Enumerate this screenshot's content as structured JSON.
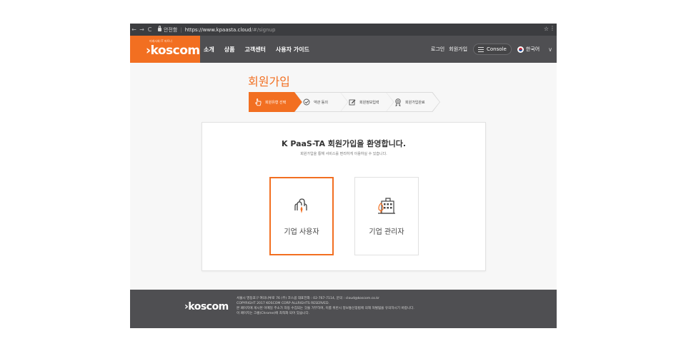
{
  "browser": {
    "back_icon": "←",
    "forward_icon": "→",
    "reload_icon": "C",
    "secure_label": "안전함",
    "url_host": "https://www.kpaasta.cloud",
    "url_path": "/#/signup",
    "bookmark_icon": "☆",
    "menu_icon": "⋮"
  },
  "header": {
    "logo_tagline": "미래사회 IT 파트너",
    "logo_text": "›koscom",
    "nav": [
      "소개",
      "상품",
      "고객센터",
      "사용자 가이드"
    ],
    "login": "로그인",
    "signup": "회원가입",
    "console": "Console",
    "language": "한국어",
    "brand_color": "#f26f21",
    "header_color": "#4f4f52"
  },
  "page": {
    "title": "회원가입",
    "steps": [
      {
        "label": "회원유형 선택",
        "icon": "pointer-hand-icon",
        "active": true
      },
      {
        "label": "약관 동의",
        "icon": "check-circle-icon",
        "active": false
      },
      {
        "label": "회원정보입력",
        "icon": "edit-icon",
        "active": false
      },
      {
        "label": "회원가입완료",
        "icon": "award-icon",
        "active": false
      }
    ]
  },
  "card": {
    "welcome": "K PaaS-TA 회원가입을 환영합니다.",
    "subtitle": "회원가입을 통해 서비스를 편리하게 이용하실 수 있습니다.",
    "options": [
      {
        "label": "기업 사용자",
        "icon": "users-icon",
        "selected": true
      },
      {
        "label": "기업 관리자",
        "icon": "building-icon",
        "selected": false
      }
    ]
  },
  "footer": {
    "logo_text": "›koscom",
    "lines": [
      "서울시 영등포구 여의나루로 76 (주) 코스콤 대표전화 : 02-767-7114, 문의 : cloud@koscom.co.kr",
      "COPYRIGHT 2017 KOSCOM CORP ALLRIGHTS RESERVED.",
      "본 페이지에 게시된 이메일 주소가 자동 수집되는 것을 거부하며, 이를 위반시 정보통신망법에 의해 처벌됨을 유의하시기 바랍니다.",
      "이 페이지는 크롬(Chrome)에 최적화 되어 있습니다."
    ]
  }
}
